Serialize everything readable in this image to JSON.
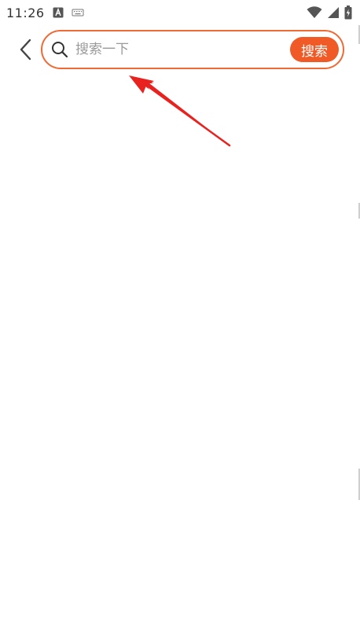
{
  "status_bar": {
    "time": "11:26",
    "icons": [
      "font-a-icon",
      "keyboard-icon",
      "wifi-icon",
      "signal-icon",
      "battery-charging-icon"
    ]
  },
  "header": {
    "back_icon": "chevron-left-icon",
    "search": {
      "icon": "search-icon",
      "placeholder": "搜索一下",
      "value": "",
      "button_label": "搜索"
    }
  },
  "colors": {
    "accent": "#f05a26",
    "search_border": "#ef6a35",
    "annotation_arrow": "#e8231f",
    "placeholder_text": "#9a9a9a"
  }
}
